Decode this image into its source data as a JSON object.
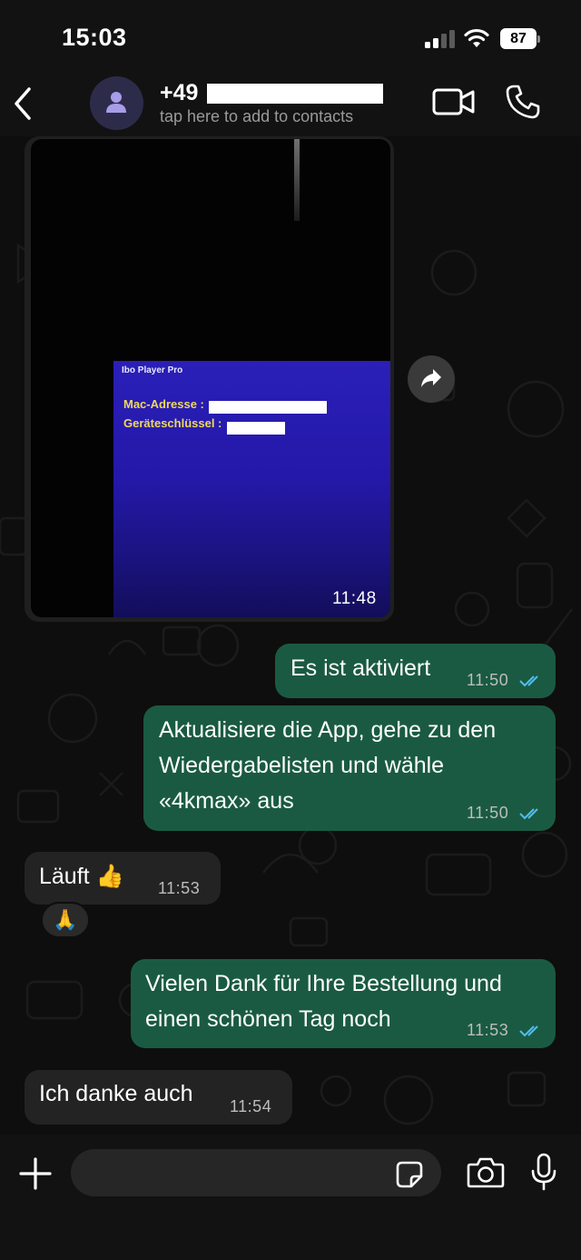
{
  "status_bar": {
    "time": "15:03",
    "battery": "87"
  },
  "header": {
    "contact_name": "+49",
    "subtitle": "tap here to add to contacts"
  },
  "messages": {
    "image_message": {
      "app_name": "Ibo Player Pro",
      "mac_label": "Mac-Adresse :",
      "key_label": "Geräteschlüssel :",
      "time": "11:48"
    },
    "m1": {
      "text": "Es ist aktiviert",
      "time": "11:50"
    },
    "m2": {
      "line1": "Aktualisiere die App, gehe zu den",
      "line2": "Wiedergabelisten und wähle",
      "line3": "«4kmax» aus",
      "time": "11:50"
    },
    "m3": {
      "text": "Läuft 👍",
      "time": "11:53",
      "reaction": "🙏"
    },
    "m4": {
      "line1": "Vielen Dank für Ihre Bestellung und",
      "line2": "einen schönen Tag noch",
      "time": "11:53"
    },
    "m5": {
      "text": "Ich danke auch",
      "time": "11:54"
    }
  },
  "colors": {
    "outgoing_bubble": "#1a5a43",
    "incoming_bubble": "#232323",
    "read_ticks": "#53bdeb"
  }
}
